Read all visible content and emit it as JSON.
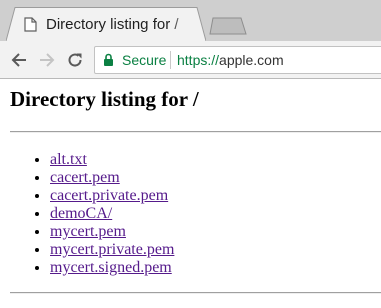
{
  "browser": {
    "tab": {
      "title": "Directory listing for /"
    },
    "address_bar": {
      "security_label": "Secure",
      "url_scheme": "https://",
      "url_host": "apple.com"
    },
    "colors": {
      "secure": "#0b8043",
      "link_visited": "#551a8b"
    },
    "icons": [
      "page-icon",
      "new-tab-icon",
      "back-icon",
      "forward-icon",
      "reload-icon",
      "lock-icon"
    ]
  },
  "page": {
    "heading": "Directory listing for /",
    "files": [
      {
        "name": "alt.txt"
      },
      {
        "name": "cacert.pem"
      },
      {
        "name": "cacert.private.pem"
      },
      {
        "name": "demoCA/"
      },
      {
        "name": "mycert.pem"
      },
      {
        "name": "mycert.private.pem"
      },
      {
        "name": "mycert.signed.pem"
      }
    ]
  }
}
